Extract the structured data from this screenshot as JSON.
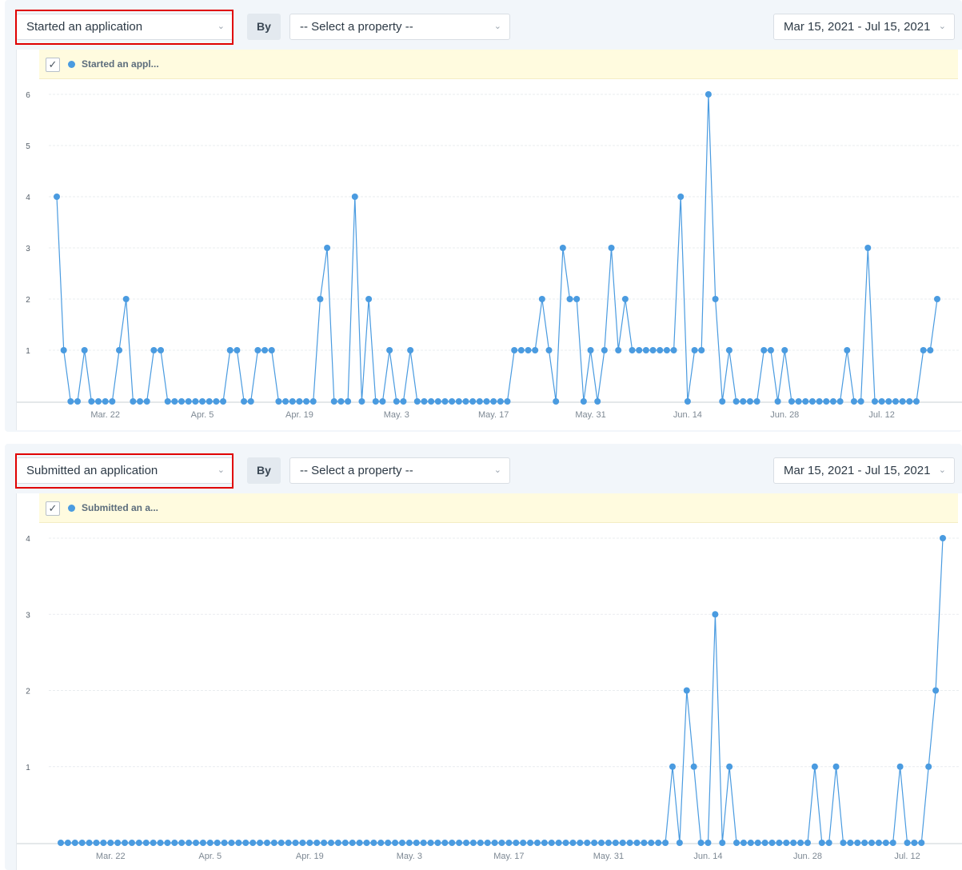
{
  "colors": {
    "line": "#4a9be0",
    "highlight": "#e00000"
  },
  "panels": [
    {
      "event_value": "Started an application",
      "by_label": "By",
      "property_value": "-- Select a property --",
      "date_range": "Mar 15, 2021 - Jul 15, 2021",
      "legend_label": "Started an appl...",
      "legend_checked": true
    },
    {
      "event_value": "Submitted an application",
      "by_label": "By",
      "property_value": "-- Select a property --",
      "date_range": "Mar 15, 2021 - Jul 15, 2021",
      "legend_label": "Submitted an a...",
      "legend_checked": true
    }
  ],
  "chart_data": [
    {
      "type": "line",
      "x_start": "2021-03-15",
      "x_end": "2021-07-15",
      "x_tick_labels": [
        "Mar. 22",
        "Apr. 5",
        "Apr. 19",
        "May. 3",
        "May. 17",
        "May. 31",
        "Jun. 14",
        "Jun. 28",
        "Jul. 12"
      ],
      "ylim": [
        0,
        6
      ],
      "y_ticks": [
        1,
        2,
        3,
        4,
        5,
        6
      ],
      "grid": true,
      "series": [
        {
          "name": "Started an appl...",
          "values": [
            4,
            1,
            0,
            0,
            1,
            0,
            0,
            0,
            0,
            1,
            2,
            0,
            0,
            0,
            1,
            1,
            0,
            0,
            0,
            0,
            0,
            0,
            0,
            0,
            0,
            1,
            1,
            0,
            0,
            1,
            1,
            1,
            0,
            0,
            0,
            0,
            0,
            0,
            2,
            3,
            0,
            0,
            0,
            4,
            0,
            2,
            0,
            0,
            1,
            0,
            0,
            1,
            0,
            0,
            0,
            0,
            0,
            0,
            0,
            0,
            0,
            0,
            0,
            0,
            0,
            0,
            1,
            1,
            1,
            1,
            2,
            1,
            0,
            3,
            2,
            2,
            0,
            1,
            0,
            1,
            3,
            1,
            2,
            1,
            1,
            1,
            1,
            1,
            1,
            1,
            4,
            0,
            1,
            1,
            6,
            2,
            0,
            1,
            0,
            0,
            0,
            0,
            1,
            1,
            0,
            1,
            0,
            0,
            0,
            0,
            0,
            0,
            0,
            0,
            1,
            0,
            0,
            3,
            0,
            0,
            0,
            0,
            0,
            0,
            0,
            1,
            1,
            2
          ]
        }
      ]
    },
    {
      "type": "line",
      "x_start": "2021-03-15",
      "x_end": "2021-07-15",
      "x_tick_labels": [
        "Mar. 22",
        "Apr. 5",
        "Apr. 19",
        "May. 3",
        "May. 17",
        "May. 31",
        "Jun. 14",
        "Jun. 28",
        "Jul. 12"
      ],
      "ylim": [
        0,
        4
      ],
      "y_ticks": [
        1,
        2,
        3,
        4
      ],
      "grid": true,
      "series": [
        {
          "name": "Submitted an a...",
          "values": [
            0,
            0,
            0,
            0,
            0,
            0,
            0,
            0,
            0,
            0,
            0,
            0,
            0,
            0,
            0,
            0,
            0,
            0,
            0,
            0,
            0,
            0,
            0,
            0,
            0,
            0,
            0,
            0,
            0,
            0,
            0,
            0,
            0,
            0,
            0,
            0,
            0,
            0,
            0,
            0,
            0,
            0,
            0,
            0,
            0,
            0,
            0,
            0,
            0,
            0,
            0,
            0,
            0,
            0,
            0,
            0,
            0,
            0,
            0,
            0,
            0,
            0,
            0,
            0,
            0,
            0,
            0,
            0,
            0,
            0,
            0,
            0,
            0,
            0,
            0,
            0,
            0,
            0,
            0,
            0,
            0,
            0,
            0,
            0,
            0,
            0,
            1,
            0,
            2,
            1,
            0,
            0,
            3,
            0,
            1,
            0,
            0,
            0,
            0,
            0,
            0,
            0,
            0,
            0,
            0,
            0,
            1,
            0,
            0,
            1,
            0,
            0,
            0,
            0,
            0,
            0,
            0,
            0,
            1,
            0,
            0,
            0,
            1,
            2,
            4
          ]
        }
      ]
    }
  ]
}
